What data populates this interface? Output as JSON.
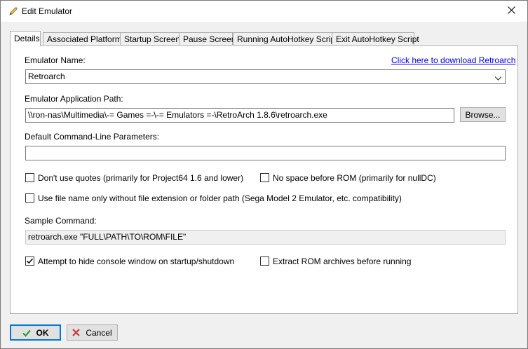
{
  "window": {
    "title": "Edit Emulator"
  },
  "tabs": [
    {
      "label": "Details",
      "active": true
    },
    {
      "label": "Associated Platforms"
    },
    {
      "label": "Startup Screen"
    },
    {
      "label": "Pause Screen"
    },
    {
      "label": "Running AutoHotkey Script"
    },
    {
      "label": "Exit AutoHotkey Script"
    }
  ],
  "details": {
    "emulator_name_label": "Emulator Name:",
    "download_link": "Click here to download Retroarch",
    "emulator_name_value": "Retroarch",
    "app_path_label": "Emulator Application Path:",
    "app_path_value": "\\\\ron-nas\\Multimedia\\-= Games =-\\-= Emulators =-\\RetroArch 1.8.6\\retroarch.exe",
    "browse_label": "Browse...",
    "cmdline_label": "Default Command-Line Parameters:",
    "cmdline_value": "",
    "options": {
      "dont_use_quotes": {
        "label": "Don't use quotes (primarily for Project64 1.6 and lower)",
        "checked": false
      },
      "no_space_before_rom": {
        "label": "No space before ROM (primarily for nullDC)",
        "checked": false
      },
      "file_name_only": {
        "label": "Use file name only without file extension or folder path (Sega Model 2 Emulator, etc. compatibility)",
        "checked": false
      },
      "hide_console": {
        "label": "Attempt to hide console window on startup/shutdown",
        "checked": true
      },
      "extract_rom": {
        "label": "Extract ROM archives before running",
        "checked": false
      }
    },
    "sample_command_label": "Sample Command:",
    "sample_command_value": "retroarch.exe \"FULL\\PATH\\TO\\ROM\\FILE\""
  },
  "footer": {
    "ok_label": "OK",
    "cancel_label": "Cancel"
  },
  "colors": {
    "ok_check": "#2e9e2e",
    "cancel_x": "#d03030",
    "link": "#0000ee",
    "focus_border": "#0078d7"
  }
}
